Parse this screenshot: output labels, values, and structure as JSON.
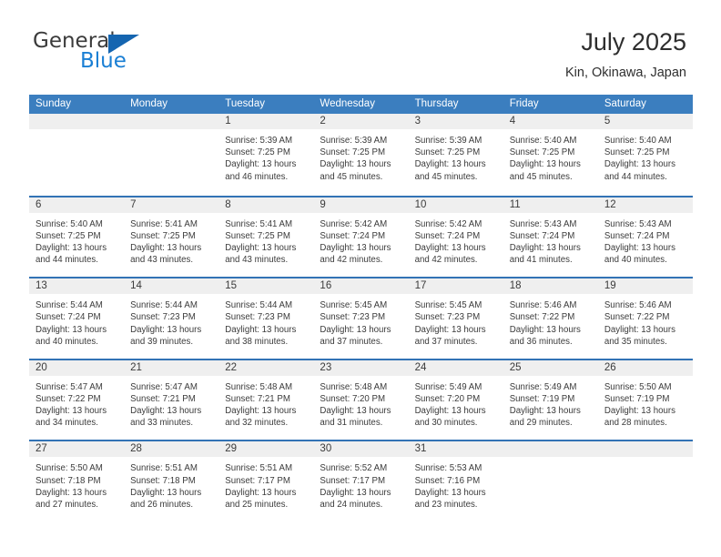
{
  "brand": {
    "name_part1": "General",
    "name_part2": "Blue",
    "flag_icon": "triangle-flag-icon",
    "accent_color": "#1a7fd4"
  },
  "header": {
    "title": "July 2025",
    "location": "Kin, Okinawa, Japan"
  },
  "theme": {
    "header_blue": "#3b7ebf",
    "row_rule_blue": "#3273b5",
    "daynum_band": "#efefef",
    "text": "#3b3b3b"
  },
  "calendar": {
    "weekday_headers": [
      "Sunday",
      "Monday",
      "Tuesday",
      "Wednesday",
      "Thursday",
      "Friday",
      "Saturday"
    ],
    "labels": {
      "sunrise": "Sunrise:",
      "sunset": "Sunset:",
      "daylight": "Daylight:"
    },
    "weeks": [
      [
        {
          "day": "",
          "empty": true,
          "line1": "",
          "line2": "",
          "line3": "",
          "line4": ""
        },
        {
          "day": "",
          "empty": true,
          "line1": "",
          "line2": "",
          "line3": "",
          "line4": ""
        },
        {
          "day": "1",
          "line1": "Sunrise: 5:39 AM",
          "line2": "Sunset: 7:25 PM",
          "line3": "Daylight: 13 hours",
          "line4": "and 46 minutes."
        },
        {
          "day": "2",
          "line1": "Sunrise: 5:39 AM",
          "line2": "Sunset: 7:25 PM",
          "line3": "Daylight: 13 hours",
          "line4": "and 45 minutes."
        },
        {
          "day": "3",
          "line1": "Sunrise: 5:39 AM",
          "line2": "Sunset: 7:25 PM",
          "line3": "Daylight: 13 hours",
          "line4": "and 45 minutes."
        },
        {
          "day": "4",
          "line1": "Sunrise: 5:40 AM",
          "line2": "Sunset: 7:25 PM",
          "line3": "Daylight: 13 hours",
          "line4": "and 45 minutes."
        },
        {
          "day": "5",
          "line1": "Sunrise: 5:40 AM",
          "line2": "Sunset: 7:25 PM",
          "line3": "Daylight: 13 hours",
          "line4": "and 44 minutes."
        }
      ],
      [
        {
          "day": "6",
          "line1": "Sunrise: 5:40 AM",
          "line2": "Sunset: 7:25 PM",
          "line3": "Daylight: 13 hours",
          "line4": "and 44 minutes."
        },
        {
          "day": "7",
          "line1": "Sunrise: 5:41 AM",
          "line2": "Sunset: 7:25 PM",
          "line3": "Daylight: 13 hours",
          "line4": "and 43 minutes."
        },
        {
          "day": "8",
          "line1": "Sunrise: 5:41 AM",
          "line2": "Sunset: 7:25 PM",
          "line3": "Daylight: 13 hours",
          "line4": "and 43 minutes."
        },
        {
          "day": "9",
          "line1": "Sunrise: 5:42 AM",
          "line2": "Sunset: 7:24 PM",
          "line3": "Daylight: 13 hours",
          "line4": "and 42 minutes."
        },
        {
          "day": "10",
          "line1": "Sunrise: 5:42 AM",
          "line2": "Sunset: 7:24 PM",
          "line3": "Daylight: 13 hours",
          "line4": "and 42 minutes."
        },
        {
          "day": "11",
          "line1": "Sunrise: 5:43 AM",
          "line2": "Sunset: 7:24 PM",
          "line3": "Daylight: 13 hours",
          "line4": "and 41 minutes."
        },
        {
          "day": "12",
          "line1": "Sunrise: 5:43 AM",
          "line2": "Sunset: 7:24 PM",
          "line3": "Daylight: 13 hours",
          "line4": "and 40 minutes."
        }
      ],
      [
        {
          "day": "13",
          "line1": "Sunrise: 5:44 AM",
          "line2": "Sunset: 7:24 PM",
          "line3": "Daylight: 13 hours",
          "line4": "and 40 minutes."
        },
        {
          "day": "14",
          "line1": "Sunrise: 5:44 AM",
          "line2": "Sunset: 7:23 PM",
          "line3": "Daylight: 13 hours",
          "line4": "and 39 minutes."
        },
        {
          "day": "15",
          "line1": "Sunrise: 5:44 AM",
          "line2": "Sunset: 7:23 PM",
          "line3": "Daylight: 13 hours",
          "line4": "and 38 minutes."
        },
        {
          "day": "16",
          "line1": "Sunrise: 5:45 AM",
          "line2": "Sunset: 7:23 PM",
          "line3": "Daylight: 13 hours",
          "line4": "and 37 minutes."
        },
        {
          "day": "17",
          "line1": "Sunrise: 5:45 AM",
          "line2": "Sunset: 7:23 PM",
          "line3": "Daylight: 13 hours",
          "line4": "and 37 minutes."
        },
        {
          "day": "18",
          "line1": "Sunrise: 5:46 AM",
          "line2": "Sunset: 7:22 PM",
          "line3": "Daylight: 13 hours",
          "line4": "and 36 minutes."
        },
        {
          "day": "19",
          "line1": "Sunrise: 5:46 AM",
          "line2": "Sunset: 7:22 PM",
          "line3": "Daylight: 13 hours",
          "line4": "and 35 minutes."
        }
      ],
      [
        {
          "day": "20",
          "line1": "Sunrise: 5:47 AM",
          "line2": "Sunset: 7:22 PM",
          "line3": "Daylight: 13 hours",
          "line4": "and 34 minutes."
        },
        {
          "day": "21",
          "line1": "Sunrise: 5:47 AM",
          "line2": "Sunset: 7:21 PM",
          "line3": "Daylight: 13 hours",
          "line4": "and 33 minutes."
        },
        {
          "day": "22",
          "line1": "Sunrise: 5:48 AM",
          "line2": "Sunset: 7:21 PM",
          "line3": "Daylight: 13 hours",
          "line4": "and 32 minutes."
        },
        {
          "day": "23",
          "line1": "Sunrise: 5:48 AM",
          "line2": "Sunset: 7:20 PM",
          "line3": "Daylight: 13 hours",
          "line4": "and 31 minutes."
        },
        {
          "day": "24",
          "line1": "Sunrise: 5:49 AM",
          "line2": "Sunset: 7:20 PM",
          "line3": "Daylight: 13 hours",
          "line4": "and 30 minutes."
        },
        {
          "day": "25",
          "line1": "Sunrise: 5:49 AM",
          "line2": "Sunset: 7:19 PM",
          "line3": "Daylight: 13 hours",
          "line4": "and 29 minutes."
        },
        {
          "day": "26",
          "line1": "Sunrise: 5:50 AM",
          "line2": "Sunset: 7:19 PM",
          "line3": "Daylight: 13 hours",
          "line4": "and 28 minutes."
        }
      ],
      [
        {
          "day": "27",
          "line1": "Sunrise: 5:50 AM",
          "line2": "Sunset: 7:18 PM",
          "line3": "Daylight: 13 hours",
          "line4": "and 27 minutes."
        },
        {
          "day": "28",
          "line1": "Sunrise: 5:51 AM",
          "line2": "Sunset: 7:18 PM",
          "line3": "Daylight: 13 hours",
          "line4": "and 26 minutes."
        },
        {
          "day": "29",
          "line1": "Sunrise: 5:51 AM",
          "line2": "Sunset: 7:17 PM",
          "line3": "Daylight: 13 hours",
          "line4": "and 25 minutes."
        },
        {
          "day": "30",
          "line1": "Sunrise: 5:52 AM",
          "line2": "Sunset: 7:17 PM",
          "line3": "Daylight: 13 hours",
          "line4": "and 24 minutes."
        },
        {
          "day": "31",
          "line1": "Sunrise: 5:53 AM",
          "line2": "Sunset: 7:16 PM",
          "line3": "Daylight: 13 hours",
          "line4": "and 23 minutes."
        },
        {
          "day": "",
          "empty": true,
          "line1": "",
          "line2": "",
          "line3": "",
          "line4": ""
        },
        {
          "day": "",
          "empty": true,
          "line1": "",
          "line2": "",
          "line3": "",
          "line4": ""
        }
      ]
    ]
  }
}
